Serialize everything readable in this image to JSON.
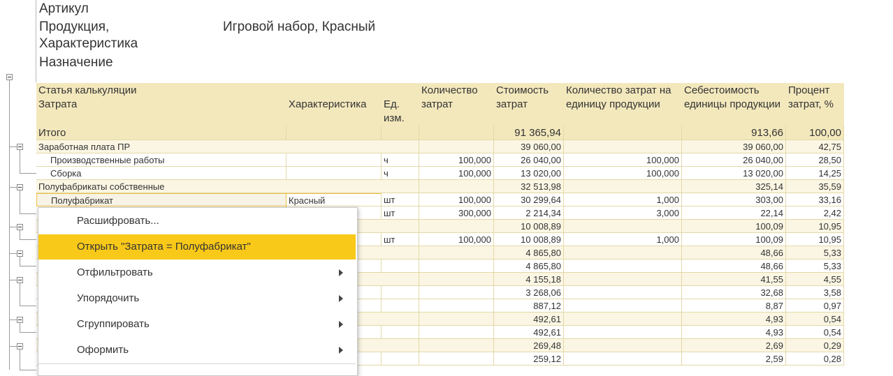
{
  "report": {
    "fields": {
      "article_label": "Артикул",
      "product_label_line1": "Продукция,",
      "product_label_line2": "Характеристика",
      "product_value": "Игровой набор, Красный",
      "purpose_label": "Назначение"
    },
    "columns": {
      "item": "Статья калькуляции",
      "cost": "Затрата",
      "characteristic": "Характеристика",
      "unit": "Ед. изм.",
      "qty": "Количество затрат",
      "amount": "Стоимость затрат",
      "qty_per_unit": "Количество затрат на единицу продукции",
      "unit_cost": "Себестоимость единицы продукции",
      "percent": "Процент затрат, %"
    },
    "rows": [
      {
        "type": "total",
        "name": "Итого",
        "char": "",
        "unit": "",
        "qty": "",
        "amount": "91 365,94",
        "qpu": "",
        "ucost": "913,66",
        "pct": "100,00"
      },
      {
        "type": "group",
        "name": "Заработная плата ПР",
        "char": "",
        "unit": "",
        "qty": "",
        "amount": "39 060,00",
        "qpu": "",
        "ucost": "39 060,00",
        "pct": "42,75"
      },
      {
        "type": "item",
        "name": "Производственные работы",
        "char": "",
        "unit": "ч",
        "qty": "100,000",
        "amount": "26 040,00",
        "qpu": "100,000",
        "ucost": "26 040,00",
        "pct": "28,50"
      },
      {
        "type": "item",
        "name": "Сборка",
        "char": "",
        "unit": "ч",
        "qty": "100,000",
        "amount": "13 020,00",
        "qpu": "100,000",
        "ucost": "13 020,00",
        "pct": "14,25"
      },
      {
        "type": "group",
        "name": "Полуфабрикаты собственные",
        "char": "",
        "unit": "",
        "qty": "",
        "amount": "32 513,98",
        "qpu": "",
        "ucost": "325,14",
        "pct": "35,59"
      },
      {
        "type": "item",
        "name": "Полуфабрикат",
        "char": "Красный",
        "unit": "шт",
        "qty": "100,000",
        "amount": "30 299,64",
        "qpu": "1,000",
        "ucost": "303,00",
        "pct": "33,16"
      },
      {
        "type": "item",
        "name": "",
        "char": "",
        "unit": "шт",
        "qty": "300,000",
        "amount": "2 214,34",
        "qpu": "3,000",
        "ucost": "22,14",
        "pct": "2,42"
      },
      {
        "type": "group",
        "name": "",
        "char": "",
        "unit": "",
        "qty": "",
        "amount": "10 008,89",
        "qpu": "",
        "ucost": "100,09",
        "pct": "10,95"
      },
      {
        "type": "item",
        "name": "",
        "char": "",
        "unit": "шт",
        "qty": "100,000",
        "amount": "10 008,89",
        "qpu": "1,000",
        "ucost": "100,09",
        "pct": "10,95"
      },
      {
        "type": "group",
        "name": "",
        "char": "",
        "unit": "",
        "qty": "",
        "amount": "4 865,80",
        "qpu": "",
        "ucost": "48,66",
        "pct": "5,33"
      },
      {
        "type": "item",
        "name": "",
        "char": "",
        "unit": "",
        "qty": "",
        "amount": "4 865,80",
        "qpu": "",
        "ucost": "48,66",
        "pct": "5,33"
      },
      {
        "type": "group",
        "name": "",
        "char": "",
        "unit": "",
        "qty": "",
        "amount": "4 155,18",
        "qpu": "",
        "ucost": "41,55",
        "pct": "4,55"
      },
      {
        "type": "item",
        "name": "",
        "char": "",
        "unit": "",
        "qty": "",
        "amount": "3 268,06",
        "qpu": "",
        "ucost": "32,68",
        "pct": "3,58"
      },
      {
        "type": "item",
        "name": "",
        "char": "",
        "unit": "",
        "qty": "",
        "amount": "887,12",
        "qpu": "",
        "ucost": "8,87",
        "pct": "0,97"
      },
      {
        "type": "group",
        "name": "",
        "char": "",
        "unit": "",
        "qty": "",
        "amount": "492,61",
        "qpu": "",
        "ucost": "4,93",
        "pct": "0,54"
      },
      {
        "type": "item",
        "name": "",
        "char": "",
        "unit": "",
        "qty": "",
        "amount": "492,61",
        "qpu": "",
        "ucost": "4,93",
        "pct": "0,54"
      },
      {
        "type": "group",
        "name": "",
        "char": "",
        "unit": "",
        "qty": "",
        "amount": "269,48",
        "qpu": "",
        "ucost": "2,69",
        "pct": "0,29"
      },
      {
        "type": "item",
        "name": "",
        "char": "",
        "unit": "",
        "qty": "",
        "amount": "259,12",
        "qpu": "",
        "ucost": "2,59",
        "pct": "0,28"
      }
    ]
  },
  "context_menu": {
    "items": [
      {
        "label": "Расшифровать...",
        "submenu": false,
        "active": false
      },
      {
        "label": "Открыть \"Затрата = Полуфабрикат\"",
        "submenu": false,
        "active": true
      },
      {
        "label": "Отфильтровать",
        "submenu": true,
        "active": false
      },
      {
        "label": "Упорядочить",
        "submenu": true,
        "active": false
      },
      {
        "label": "Сгруппировать",
        "submenu": true,
        "active": false
      },
      {
        "label": "Оформить",
        "submenu": true,
        "active": false
      }
    ]
  },
  "colors": {
    "header_bg": "#f3e8bc",
    "group_bg": "#fbf6e3",
    "total_bg": "#f3e8bc",
    "grid": "#e3d8a8",
    "menu_active": "#f9c919"
  }
}
